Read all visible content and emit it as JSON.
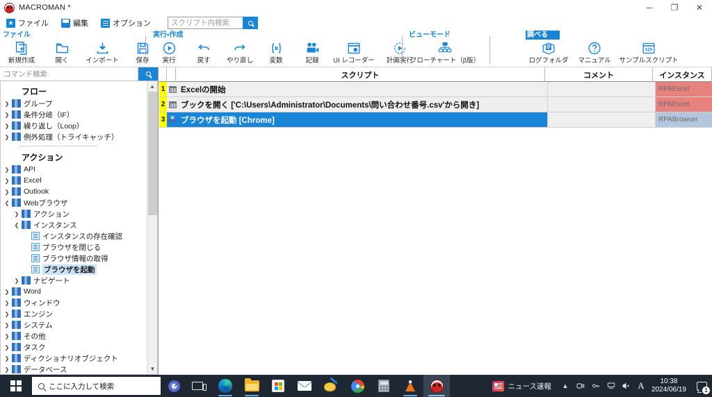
{
  "window": {
    "title": "MACROMAN *",
    "logo_icon": "macroman-logo-icon",
    "minimize_label": "─",
    "maximize_label": "❐",
    "close_label": "✕"
  },
  "menubar": {
    "items": [
      {
        "label": "ファイル",
        "icon": "file-menu-icon"
      },
      {
        "label": "編集",
        "icon": "edit-menu-icon"
      },
      {
        "label": "オプション",
        "icon": "options-menu-icon"
      }
    ],
    "search": {
      "placeholder": "スクリプト内検索",
      "value": "",
      "button_icon": "search-icon"
    }
  },
  "ribbon": {
    "groups": [
      {
        "label": "ファイル",
        "selected": false,
        "buttons": [
          {
            "label": "新規作成",
            "icon": "new-file-icon"
          },
          {
            "label": "開く",
            "icon": "open-folder-icon"
          },
          {
            "label": "インポート",
            "icon": "import-icon"
          },
          {
            "label": "保存",
            "icon": "save-icon"
          }
        ]
      },
      {
        "label": "実行・作成",
        "selected": false,
        "buttons": [
          {
            "label": "実行",
            "icon": "run-icon"
          },
          {
            "label": "戻す",
            "icon": "undo-icon"
          },
          {
            "label": "やり直し",
            "icon": "redo-icon"
          },
          {
            "label": "変数",
            "icon": "variables-icon"
          },
          {
            "label": "記録",
            "icon": "record-icon"
          },
          {
            "label": "UI レコーダー",
            "icon": "ui-recorder-icon"
          },
          {
            "label": "計画実行",
            "icon": "scheduled-run-icon"
          }
        ]
      },
      {
        "label": "ビューモード",
        "selected": false,
        "buttons": [
          {
            "label": "フローチャート（β版）",
            "icon": "flowchart-icon"
          }
        ]
      },
      {
        "label": "調べる",
        "selected": true,
        "buttons": [
          {
            "label": "ログフォルダ",
            "icon": "log-folder-icon"
          },
          {
            "label": "マニュアル",
            "icon": "manual-icon"
          },
          {
            "label": "サンプルスクリプト",
            "icon": "sample-script-icon"
          }
        ]
      }
    ]
  },
  "sidebar": {
    "search": {
      "placeholder": "コマンド検索",
      "value": "",
      "button_icon": "search-icon"
    },
    "sections": [
      {
        "heading": "フロー",
        "items": [
          {
            "label": "グループ",
            "type": "folder",
            "expanded": false,
            "depth": 0,
            "selected": false
          },
          {
            "label": "条件分岐（IF）",
            "type": "folder",
            "expanded": false,
            "depth": 0,
            "selected": false
          },
          {
            "label": "繰り返し（Loop）",
            "type": "folder",
            "expanded": false,
            "depth": 0,
            "selected": false
          },
          {
            "label": "例外処理（トライキャッチ）",
            "type": "folder",
            "expanded": false,
            "depth": 0,
            "selected": false
          }
        ]
      },
      {
        "heading": "アクション",
        "items": [
          {
            "label": "API",
            "type": "folder",
            "expanded": false,
            "depth": 0,
            "selected": false
          },
          {
            "label": "Excel",
            "type": "folder",
            "expanded": false,
            "depth": 0,
            "selected": false
          },
          {
            "label": "Outlook",
            "type": "folder",
            "expanded": false,
            "depth": 0,
            "selected": false
          },
          {
            "label": "Webブラウザ",
            "type": "folder",
            "expanded": true,
            "depth": 0,
            "selected": false
          },
          {
            "label": "アクション",
            "type": "folder",
            "expanded": false,
            "depth": 1,
            "selected": false
          },
          {
            "label": "インスタンス",
            "type": "folder",
            "expanded": true,
            "depth": 1,
            "selected": false
          },
          {
            "label": "インスタンスの存在確認",
            "type": "doc",
            "depth": 2,
            "selected": false
          },
          {
            "label": "ブラウザを閉じる",
            "type": "doc",
            "depth": 2,
            "selected": false
          },
          {
            "label": "ブラウザ情報の取得",
            "type": "doc",
            "depth": 2,
            "selected": false
          },
          {
            "label": "ブラウザを起動",
            "type": "doc",
            "depth": 2,
            "selected": true
          },
          {
            "label": "ナビゲート",
            "type": "folder",
            "expanded": false,
            "depth": 1,
            "selected": false
          },
          {
            "label": "Word",
            "type": "folder",
            "expanded": false,
            "depth": 0,
            "selected": false
          },
          {
            "label": "ウィンドウ",
            "type": "folder",
            "expanded": false,
            "depth": 0,
            "selected": false
          },
          {
            "label": "エンジン",
            "type": "folder",
            "expanded": false,
            "depth": 0,
            "selected": false
          },
          {
            "label": "システム",
            "type": "folder",
            "expanded": false,
            "depth": 0,
            "selected": false
          },
          {
            "label": "その他",
            "type": "folder",
            "expanded": false,
            "depth": 0,
            "selected": false
          },
          {
            "label": "タスク",
            "type": "folder",
            "expanded": false,
            "depth": 0,
            "selected": false
          },
          {
            "label": "ディクショナリオブジェクト",
            "type": "folder",
            "expanded": false,
            "depth": 0,
            "selected": false
          },
          {
            "label": "データベース",
            "type": "folder",
            "expanded": false,
            "depth": 0,
            "selected": false
          }
        ]
      }
    ]
  },
  "grid": {
    "columns": {
      "number": "",
      "icon": "",
      "script": "スクリプト",
      "comment": "コメント",
      "instance": "インスタンス"
    },
    "rows": [
      {
        "number": "1",
        "icon": "excel-row-icon",
        "script": "Excelの開始",
        "comment": "",
        "instance": "RPAExcel",
        "instance_color": "#e8827e",
        "selected": false
      },
      {
        "number": "2",
        "icon": "excel-row-icon",
        "script": "ブックを開く ['C:\\Users\\Administrator\\Documents\\問い合わせ番号.csv'から開き]",
        "comment": "",
        "instance": "RPAExcel",
        "instance_color": "#e8827e",
        "selected": false
      },
      {
        "number": "3",
        "icon": "browser-row-icon",
        "script": "ブラウザを起動 [Chrome]",
        "comment": "",
        "instance": "RPABrowser",
        "instance_color": "#b3c6dd",
        "selected": true
      }
    ]
  },
  "taskbar": {
    "start_icon": "windows-start-icon",
    "search": {
      "placeholder": "ここに入力して検索",
      "icon": "search-icon"
    },
    "cortana_icon": "cortana-icon",
    "taskview_icon": "task-view-icon",
    "apps": [
      {
        "name": "edge",
        "icon": "edge-icon",
        "state": "running"
      },
      {
        "name": "explorer",
        "icon": "file-explorer-icon",
        "state": "running"
      },
      {
        "name": "store",
        "icon": "microsoft-store-icon",
        "state": "pinned"
      },
      {
        "name": "mail",
        "icon": "mail-icon",
        "state": "pinned"
      },
      {
        "name": "paint",
        "icon": "paint-icon",
        "state": "pinned"
      },
      {
        "name": "chrome",
        "icon": "chrome-icon",
        "state": "pinned"
      },
      {
        "name": "calculator",
        "icon": "calculator-icon",
        "state": "pinned"
      },
      {
        "name": "vlc",
        "icon": "vlc-icon",
        "state": "running"
      },
      {
        "name": "macroman",
        "icon": "macroman-icon",
        "state": "active"
      }
    ],
    "tray": {
      "news_label": "ニュース速報",
      "news_icon": "news-icon",
      "chevron_icon": "chevron-up-icon",
      "icons": [
        {
          "icon": "meet-now-icon",
          "glyph": "☉"
        },
        {
          "icon": "network-key-icon",
          "glyph": "⚿"
        },
        {
          "icon": "network-icon",
          "glyph": "☐"
        },
        {
          "icon": "volume-muted-icon",
          "glyph": "⧻"
        }
      ],
      "ime_label": "A",
      "time": "10:38",
      "date": "2024/06/19",
      "notification_icon": "notification-icon",
      "notification_count": "1"
    }
  }
}
